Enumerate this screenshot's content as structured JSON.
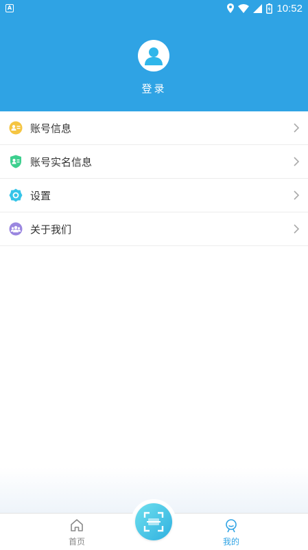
{
  "status_bar": {
    "app_badge": "A",
    "time": "10:52",
    "icons": [
      "location-icon",
      "wifi-icon",
      "signal-icon",
      "battery-icon"
    ]
  },
  "header": {
    "login_label": "登录",
    "background": "#2fa3e4"
  },
  "menu": {
    "items": [
      {
        "label": "账号信息",
        "icon": "account-info-icon",
        "color": "#f5c542"
      },
      {
        "label": "账号实名信息",
        "icon": "id-verify-icon",
        "color": "#3dcf8e"
      },
      {
        "label": "设置",
        "icon": "settings-icon",
        "color": "#35c4e8"
      },
      {
        "label": "关于我们",
        "icon": "about-us-icon",
        "color": "#9b87e0"
      }
    ]
  },
  "tabbar": {
    "home_label": "首页",
    "mine_label": "我的",
    "scan_icon": "scan-icon",
    "active_color": "#2fa3e4",
    "inactive_color": "#888888"
  }
}
